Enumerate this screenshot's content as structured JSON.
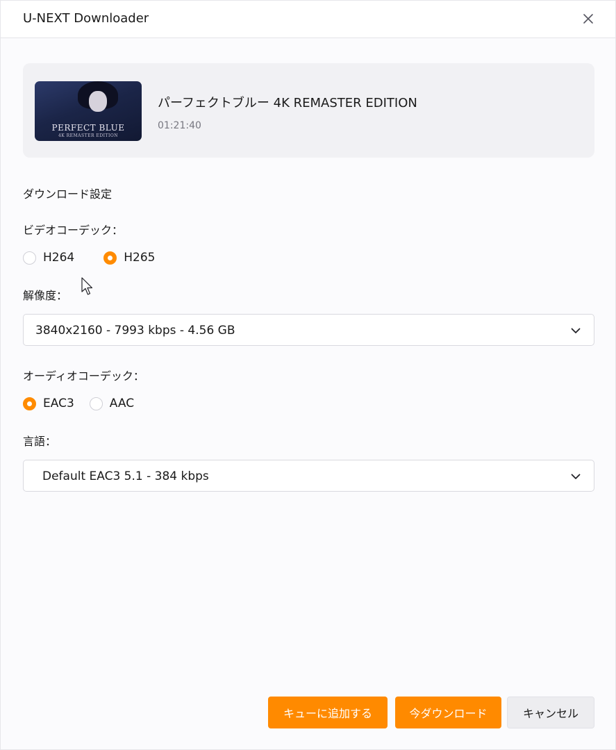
{
  "window": {
    "title": "U-NEXT Downloader"
  },
  "media": {
    "title": "パーフェクトブルー 4K REMASTER EDITION",
    "duration": "01:21:40",
    "thumbnail_title": "PERFECT BLUE",
    "thumbnail_subtitle": "4K REMASTER EDITION"
  },
  "settings": {
    "heading": "ダウンロード設定",
    "video_codec": {
      "label": "ビデオコーデック：",
      "options": [
        {
          "label": "H264",
          "checked": false
        },
        {
          "label": "H265",
          "checked": true
        }
      ]
    },
    "resolution": {
      "label": "解像度：",
      "selected": "3840x2160 - 7993 kbps - 4.56 GB"
    },
    "audio_codec": {
      "label": "オーディオコーデック：",
      "options": [
        {
          "label": "EAC3",
          "checked": true
        },
        {
          "label": "AAC",
          "checked": false
        }
      ]
    },
    "language": {
      "label": "言語：",
      "selected": "Default EAC3 5.1 - 384 kbps"
    }
  },
  "buttons": {
    "add_to_queue": "キューに追加する",
    "download_now": "今ダウンロード",
    "cancel": "キャンセル"
  },
  "colors": {
    "accent": "#ff8a00",
    "card_background": "#f1f1f4",
    "dialog_background": "#fbfbfd"
  },
  "icons": {
    "close": "close-icon",
    "dropdown": "chevron-down-icon",
    "cursor": "mouse-cursor-icon"
  }
}
